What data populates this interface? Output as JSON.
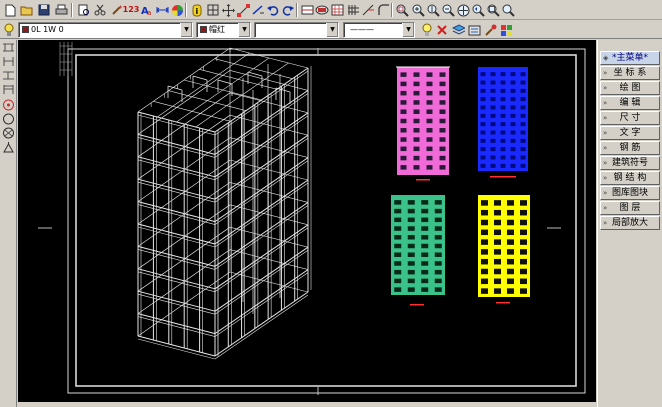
{
  "toolbar": {
    "icons": [
      "new-file-icon",
      "open-folder-icon",
      "save-icon",
      "print-icon",
      "print-preview-icon",
      "cut-icon",
      "copy-icon",
      "paste-icon",
      "match-properties-icon",
      "line-tool-icon",
      "number-123-icon",
      "text-ab-icon",
      "dimension-icon",
      "color-wheel-icon",
      "info-icon",
      "grid-icon",
      "move-icon",
      "node-icon",
      "edit-line-icon",
      "undo-icon",
      "redo-icon",
      "block-icon",
      "rectangle-icon",
      "hatch-icon",
      "break-icon",
      "fillet-icon",
      "zoom-window-icon",
      "zoom-in-icon",
      "zoom-out-icon",
      "zoom-realtime-icon",
      "pan-icon",
      "zoom-previous-icon",
      "zoom-extents-icon"
    ],
    "number_label": "123",
    "info_label": "i"
  },
  "properties": {
    "layer_value": "0L    1W       0",
    "color_value": "帽红",
    "linetype_value": "",
    "lineweight_value": "———",
    "layer_color": "#8b1a1a",
    "color_swatch": "#8b1a1a"
  },
  "left_tools": [
    "line-h-icon",
    "line-v-icon",
    "dim-h-icon",
    "dim-v-icon",
    "arc-icon",
    "circle-icon",
    "polygon-icon",
    "triangle-icon"
  ],
  "screen_menu": {
    "header": "*主菜单*",
    "items": [
      "坐 标 系",
      "绘    图",
      "编    辑",
      "尺    寸",
      "文    字",
      "钢    筋",
      "建筑符号",
      "钢 结 构",
      "图库图块",
      "图    层",
      "局部放大"
    ]
  },
  "colors": {
    "canvas": "#000000",
    "wireframe": "#e6e6e6",
    "panel1_bg": "#f06ad8",
    "panel1_windows": "#2a1a3a",
    "panel2_bg": "#1a2aff",
    "panel3_bg": "#3ac28a",
    "panel4_bg": "#ffff00",
    "panel4_windows": "#111111"
  }
}
